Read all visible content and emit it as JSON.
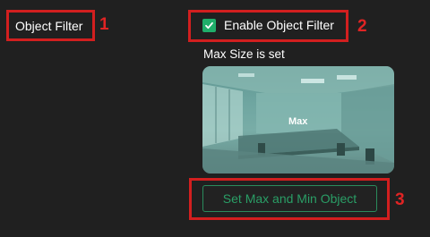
{
  "section": {
    "title": "Object Filter"
  },
  "filter": {
    "checkbox_label": "Enable Object Filter",
    "checked": true,
    "status_text": "Max Size is set"
  },
  "preview": {
    "overlay_label": "Max"
  },
  "actions": {
    "set_button_label": "Set Max and Min Object"
  },
  "annotations": [
    "1",
    "2",
    "3"
  ],
  "colors": {
    "accent": "#1fae6a",
    "annotation": "#d21f1f",
    "background": "#202020"
  }
}
